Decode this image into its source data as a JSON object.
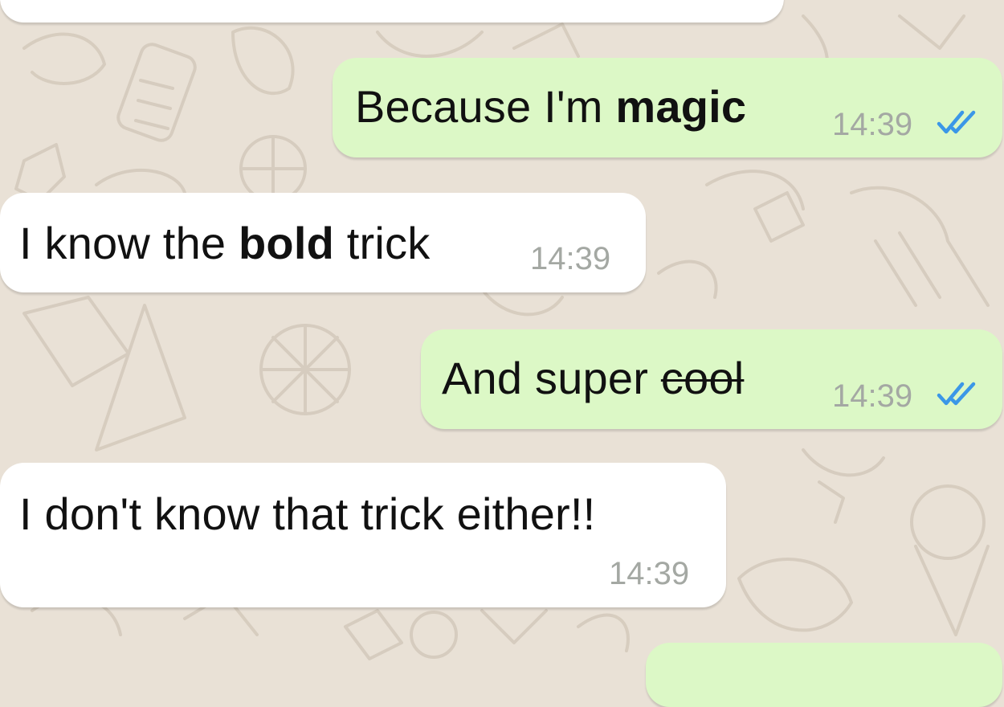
{
  "chat": {
    "colors": {
      "wallpaper": "#e9e1d6",
      "incoming_bubble": "#ffffff",
      "outgoing_bubble": "#dcf8c6",
      "timestamp": "#a4a8a3",
      "read_ticks": "#3b97e7"
    },
    "messages": [
      {
        "direction": "outgoing",
        "parts": {
          "p1": "Because I'm ",
          "p2": "magic"
        },
        "time": "14:39",
        "status_icon": "double-check-read-icon"
      },
      {
        "direction": "incoming",
        "parts": {
          "p1": "I know the ",
          "p2": "bold",
          "p3": " trick"
        },
        "time": "14:39"
      },
      {
        "direction": "outgoing",
        "parts": {
          "p1": "And super ",
          "p2": "cool"
        },
        "time": "14:39",
        "status_icon": "double-check-read-icon"
      },
      {
        "direction": "incoming",
        "parts": {
          "p1": "I don't know that trick either!!"
        },
        "time": "14:39"
      }
    ]
  }
}
